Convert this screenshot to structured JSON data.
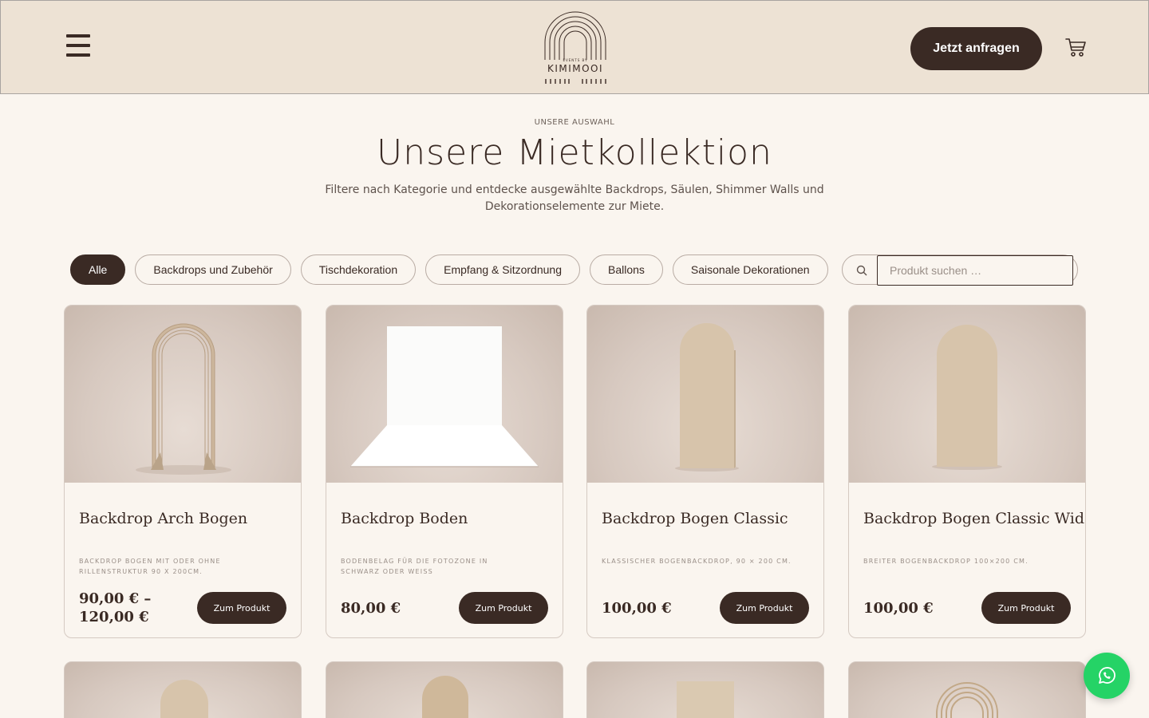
{
  "header": {
    "logo_small_text": "EVENTS BY",
    "logo_text": "KIMIMOOI",
    "cta_label": "Jetzt anfragen"
  },
  "intro": {
    "eyebrow": "UNSERE AUSWAHL",
    "title": "Unsere Mietkollektion",
    "subtitle": "Filtere nach Kategorie und entdecke ausgewählte Backdrops, Säulen, Shimmer Walls und Dekorationselemente zur Miete."
  },
  "filters": [
    {
      "label": "Alle",
      "active": true
    },
    {
      "label": "Backdrops und Zubehör"
    },
    {
      "label": "Tischdekoration"
    },
    {
      "label": "Empfang & Sitzordnung"
    },
    {
      "label": "Ballons"
    },
    {
      "label": "Saisonale Dekorationen"
    }
  ],
  "search": {
    "placeholder": "Produkt suchen …"
  },
  "products": [
    {
      "name": "Backdrop Arch Bogen",
      "desc": "BACKDROP BOGEN MIT ODER OHNE RILLENSTRUKTUR 90 X 200CM.",
      "price": "90,00 € – 120,00 €",
      "button": "Zum Produkt"
    },
    {
      "name": "Backdrop Boden",
      "desc": "BODENBELAG FÜR DIE FOTOZONE IN SCHWARZ ODER WEISS",
      "price": "80,00 €",
      "button": "Zum Produkt"
    },
    {
      "name": "Backdrop Bogen Classic",
      "desc": "KLASSISCHER BOGENBACKDROP, 90 × 200 CM.",
      "price": "100,00 €",
      "button": "Zum Produkt"
    },
    {
      "name": "Backdrop Bogen Classic Wide",
      "desc": "BREITER BOGENBACKDROP 100×200 CM.",
      "price": "100,00 €",
      "button": "Zum Produkt"
    }
  ],
  "colors": {
    "primary": "#3a2a24",
    "header_bg": "#ede2d4",
    "page_bg": "#faf5ef",
    "whatsapp": "#25d366"
  },
  "icons": [
    "menu-icon",
    "cart-icon",
    "search-icon",
    "whatsapp-icon"
  ]
}
